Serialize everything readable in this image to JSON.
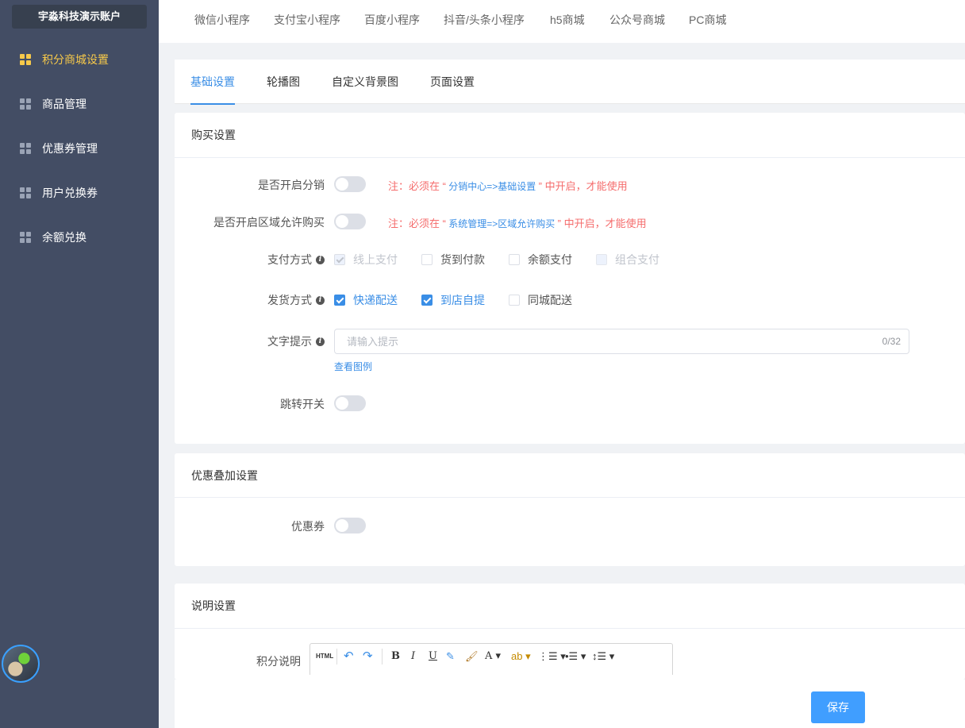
{
  "sidebar": {
    "account": "宇淼科技演示账户",
    "items": [
      {
        "label": "积分商城设置",
        "active": true
      },
      {
        "label": "商品管理"
      },
      {
        "label": "优惠券管理"
      },
      {
        "label": "用户兑换券"
      },
      {
        "label": "余额兑换"
      }
    ]
  },
  "platform_tabs": [
    "微信小程序",
    "支付宝小程序",
    "百度小程序",
    "抖音/头条小程序",
    "h5商城",
    "公众号商城",
    "PC商城"
  ],
  "settings_tabs": [
    {
      "label": "基础设置",
      "active": true
    },
    {
      "label": "轮播图"
    },
    {
      "label": "自定义背景图"
    },
    {
      "label": "页面设置"
    }
  ],
  "purchase": {
    "title": "购买设置",
    "distribution": {
      "label": "是否开启分销",
      "on": false,
      "note_prefix": "注：必须在 “",
      "note_path": " 分销中心=>基础设置 ",
      "note_suffix": "” 中开启，才能使用"
    },
    "region": {
      "label": "是否开启区域允许购买",
      "on": false,
      "note_prefix": "注：必须在 “",
      "note_path": " 系统管理=>区域允许购买 ",
      "note_suffix": "” 中开启，才能使用"
    },
    "payment": {
      "label": "支付方式",
      "options": [
        "线上支付",
        "货到付款",
        "余额支付",
        "组合支付"
      ]
    },
    "delivery": {
      "label": "发货方式",
      "options": [
        "快递配送",
        "到店自提",
        "同城配送"
      ]
    },
    "tip": {
      "label": "文字提示",
      "placeholder": "请输入提示",
      "value": "",
      "counter": "0/32",
      "example_link": "查看图例"
    },
    "redirect": {
      "label": "跳转开关",
      "on": false
    }
  },
  "discount": {
    "title": "优惠叠加设置",
    "coupon": {
      "label": "优惠券",
      "on": false
    }
  },
  "description": {
    "title": "说明设置",
    "points_label": "积分说明",
    "toolbar": {
      "html": "HTML",
      "bold": "B",
      "italic": "I",
      "underline": "U",
      "font_color": "A"
    }
  },
  "footer": {
    "save_label": "保存"
  },
  "colors": {
    "primary": "#409eff",
    "sidebar": "#434d64",
    "active_nav": "#f7c94a",
    "note": "#f56c6c"
  }
}
